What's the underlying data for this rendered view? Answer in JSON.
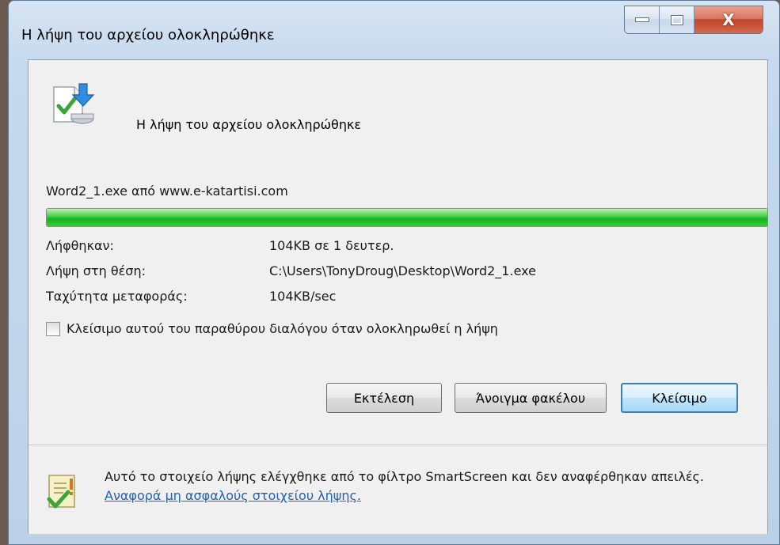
{
  "window": {
    "title": "Η λήψη του αρχείου ολοκληρώθηκε",
    "minimize_icon": "minimize-icon",
    "maximize_icon": "maximize-icon",
    "close_glyph": "X"
  },
  "header": {
    "icon": "download-complete-icon",
    "text": "Η λήψη του αρχείου ολοκληρώθηκε"
  },
  "file_line": "Word2_1.exe από www.e-katartisi.com",
  "progress": {
    "percent": 100
  },
  "info": [
    {
      "label": "Λήφθηκαν:",
      "value": "104KB σε 1 δευτερ."
    },
    {
      "label": "Λήψη στη θέση:",
      "value": "C:\\Users\\TonyDroug\\Desktop\\Word2_1.exe"
    },
    {
      "label": "Ταχύτητα μεταφοράς:",
      "value": "104KB/sec"
    }
  ],
  "checkbox": {
    "label": "Κλείσιμο αυτού του παραθύρου διαλόγου όταν ολοκληρωθεί η λήψη",
    "checked": false
  },
  "buttons": {
    "run": "Εκτέλεση",
    "open_folder": "Άνοιγμα φακέλου",
    "close": "Κλείσιμο"
  },
  "footer": {
    "icon": "smartscreen-shield-icon",
    "text": "Αυτό το στοιχείο λήψης ελέγχθηκε από το φίλτρο SmartScreen και δεν αναφέρθηκαν απειλές.",
    "link": "Αναφορά μη ασφαλούς στοιχείου λήψης."
  }
}
